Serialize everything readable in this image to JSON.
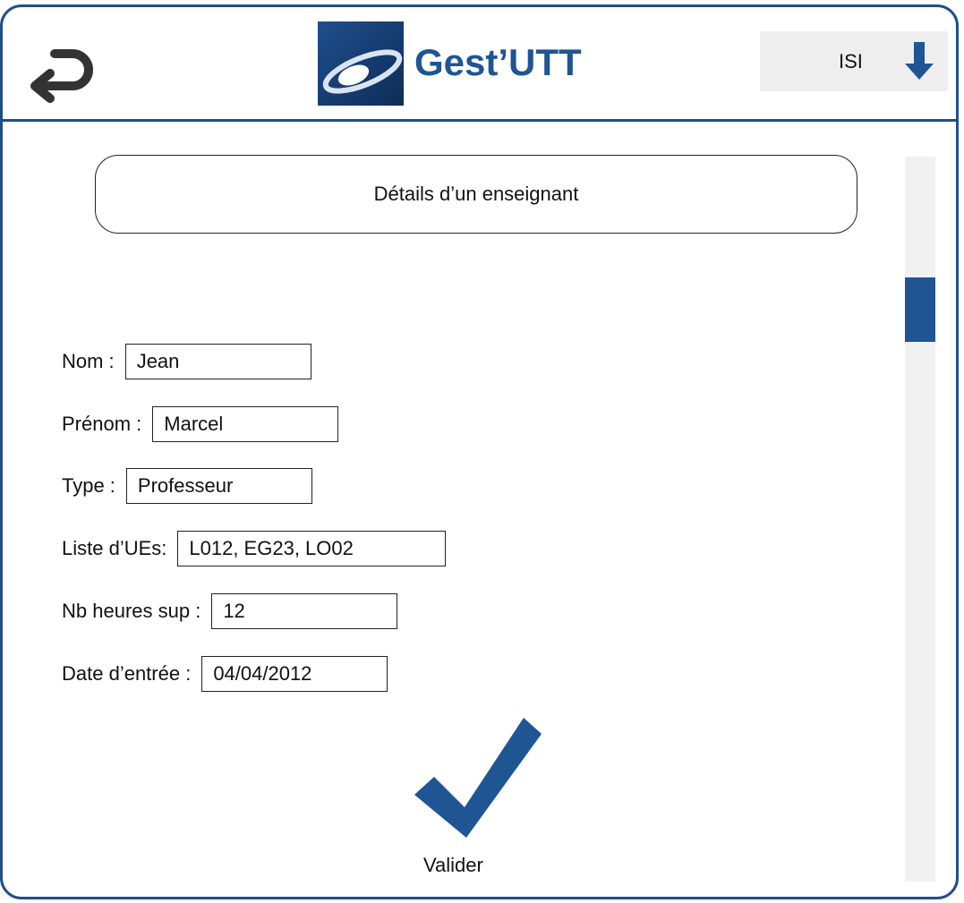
{
  "header": {
    "title": "Gest’UTT",
    "department": {
      "value": "ISI"
    }
  },
  "page": {
    "heading": "Détails d’un enseignant"
  },
  "fields": {
    "nom": {
      "label": "Nom :",
      "value": "Jean"
    },
    "prenom": {
      "label": "Prénom :",
      "value": "Marcel"
    },
    "type": {
      "label": "Type :",
      "value": "Professeur"
    },
    "ues": {
      "label": "Liste d’UEs:",
      "value": "L012, EG23, LO02"
    },
    "heures": {
      "label": "Nb heures sup :",
      "value": "12"
    },
    "date": {
      "label": "Date d’entrée :",
      "value": "04/04/2012"
    }
  },
  "actions": {
    "validate_label": "Valider"
  },
  "colors": {
    "accent": "#1f5593",
    "border": "#1f4e8a",
    "select_bg": "#eeeeee"
  },
  "icons": {
    "back": "return-arrow-icon",
    "logo": "gest-utt-logo",
    "dropdown": "down-arrow-icon",
    "validate": "checkmark-icon"
  }
}
